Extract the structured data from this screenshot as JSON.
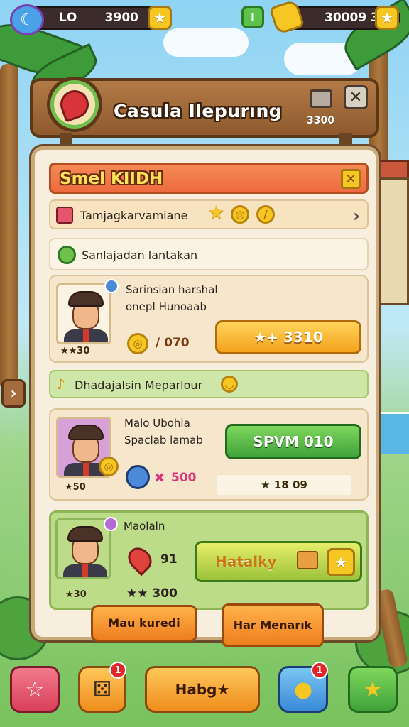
{
  "topbar": {
    "left_label": "ꓡO",
    "left_value": "3900",
    "right_value": "30009 3",
    "green_label": "I"
  },
  "header": {
    "title": "Casula Ilepurıng",
    "value": "3300",
    "close": "✕"
  },
  "panel": {
    "title": "Smel KIIDH",
    "close": "✕",
    "row1_text": "Tamjagkarvamiane",
    "row2_text": "Sanlajadan lantakan",
    "note_text": "Dhadajalsin Meparlour"
  },
  "cards": [
    {
      "name": "Sarinsian harshal",
      "subtitle": "onepI Hunoaab",
      "level": "★★30",
      "stat": "/ 070",
      "button": "★+ 3310"
    },
    {
      "name": "Malo Ubohla",
      "subtitle": "Spaclab lamab",
      "level": "★50",
      "stat": "500",
      "button": "SPVM 010",
      "price": "★ 18 09"
    },
    {
      "name": "Maolaln",
      "level": "★30",
      "stat_top": "91",
      "stat": "★★ 300",
      "button": "Hatalky"
    }
  ],
  "panel_buttons": {
    "left": "Mau kuredi",
    "right": "Har Menarık"
  },
  "bottom_nav": {
    "center": "Habg★",
    "badge1": "1",
    "badge2": "1"
  },
  "colors": {
    "accent_orange": "#f3a21d",
    "accent_green": "#3fa33a",
    "panel_bg": "#f7eede",
    "wood": "#8e5a2e"
  },
  "icons": [
    "star-icon",
    "coin-icon",
    "cart-icon",
    "close-icon",
    "chevron-right-icon",
    "pin-icon",
    "compass-icon",
    "heart-icon"
  ]
}
